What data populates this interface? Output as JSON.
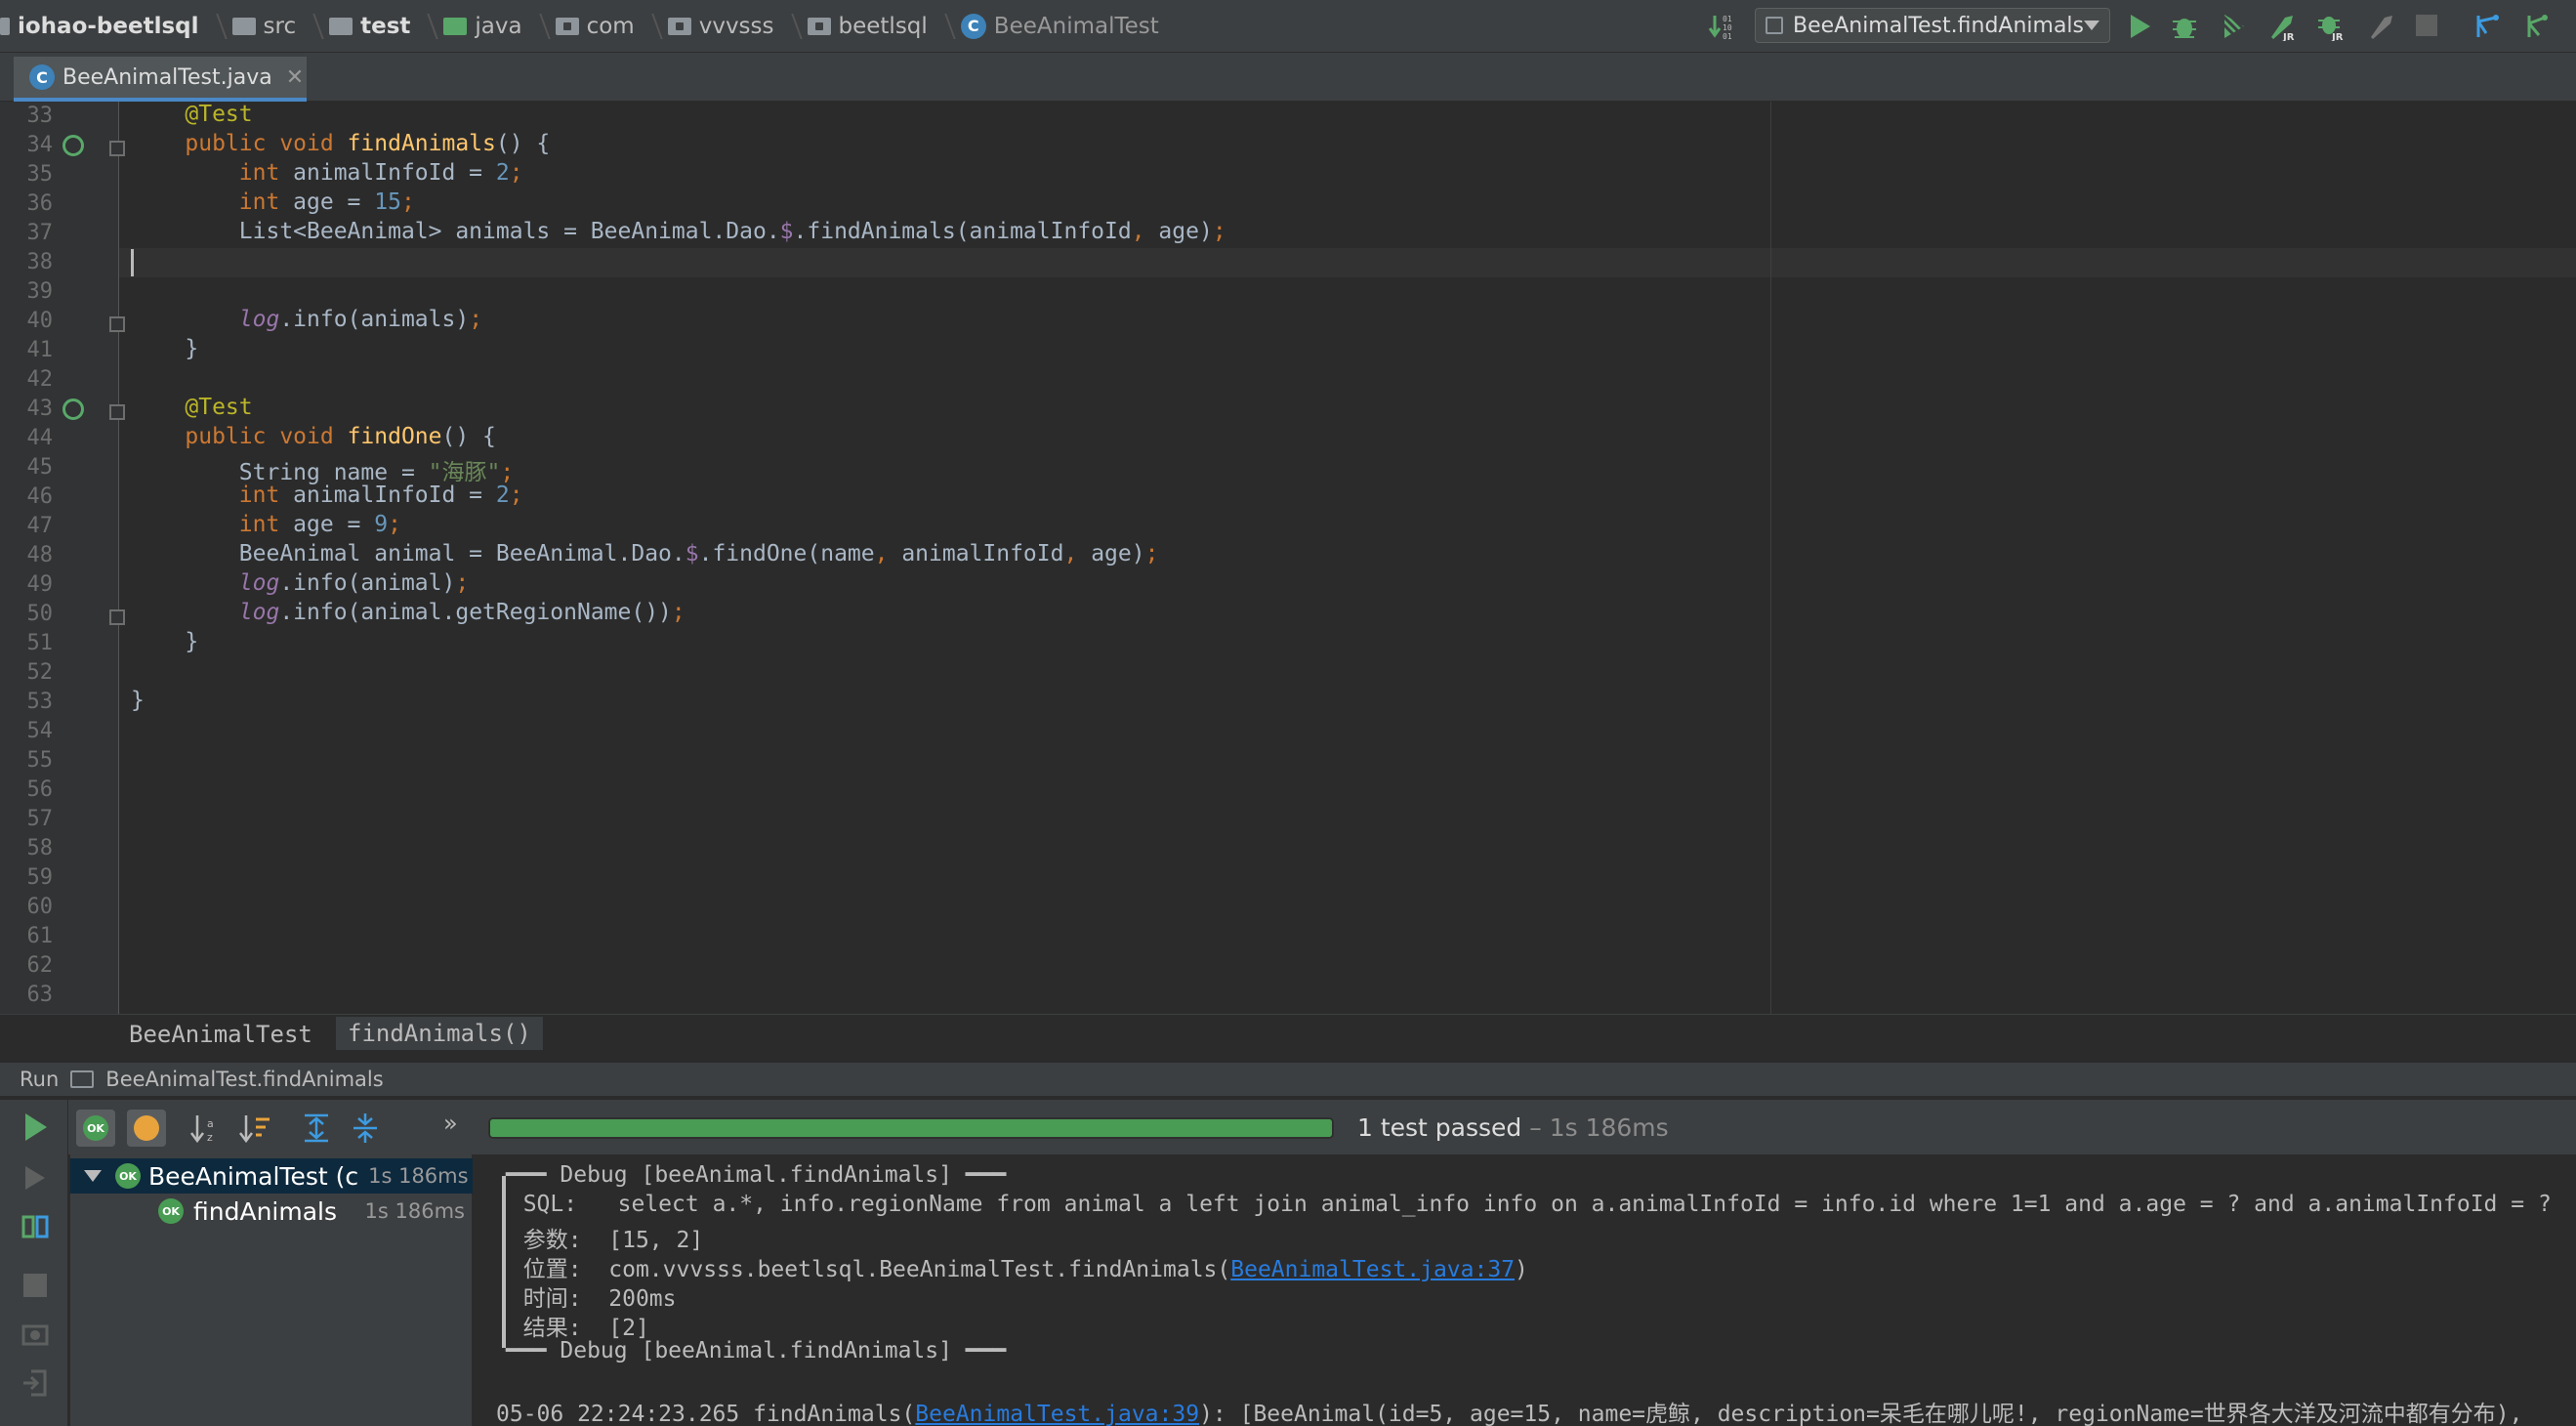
{
  "navbar": {
    "crumbs": [
      {
        "label": "iohao-beetlsql",
        "icon": "module-folder-icon",
        "bold": true
      },
      {
        "label": "src",
        "icon": "folder-icon"
      },
      {
        "label": "test",
        "icon": "folder-icon",
        "bold": true
      },
      {
        "label": "java",
        "icon": "green-folder-icon"
      },
      {
        "label": "com",
        "icon": "package-icon"
      },
      {
        "label": "vvvsss",
        "icon": "package-icon"
      },
      {
        "label": "beetlsql",
        "icon": "package-icon"
      },
      {
        "label": "BeeAnimalTest",
        "icon": "class-icon"
      }
    ],
    "run_config": "BeeAnimalTest.findAnimals"
  },
  "editor_tab": {
    "label": "BeeAnimalTest.java",
    "icon_letter": "C"
  },
  "code": {
    "line_numbers": [
      "33",
      "34",
      "35",
      "36",
      "37",
      "38",
      "39",
      "40",
      "41",
      "42",
      "43",
      "44",
      "45",
      "46",
      "47",
      "48",
      "49",
      "50",
      "51",
      "52",
      "53",
      "54",
      "55",
      "56",
      "57",
      "58",
      "59",
      "60",
      "61",
      "62",
      "63"
    ]
  },
  "editor_breadcrumb": {
    "class_name": "BeeAnimalTest",
    "method_name": "findAnimals()"
  },
  "run_panel": {
    "label": "Run",
    "config": "BeeAnimalTest.findAnimals",
    "status_text": "1 test passed",
    "status_time": " – 1s 186ms",
    "progress": 1.0,
    "tree": [
      {
        "label": "BeeAnimalTest (c",
        "duration": "1s 186ms",
        "badge": "OK"
      },
      {
        "label": "findAnimals",
        "duration": "1s 186ms",
        "badge": "OK"
      }
    ]
  },
  "console": {
    "header_top": "Debug [beeAnimal.findAnimals] ━━━",
    "sql_label": "SQL:",
    "sql_value": "select a.*, info.regionName from animal a left join animal_info info on a.animalInfoId = info.id where 1=1 and a.age = ? and a.animalInfoId = ?",
    "params_label": "参数:",
    "params_value": "[15, 2]",
    "location_label": "位置:",
    "location_value": "com.vvvsss.beetlsql.BeeAnimalTest.findAnimals(",
    "location_link": "BeeAnimalTest.java:37",
    "location_end": ")",
    "time_label": "时间:",
    "time_value": "200ms",
    "result_label": "结果:",
    "result_value": "[2]",
    "header_bottom": "Debug [beeAnimal.findAnimals] ━━━",
    "log_prefix": "05-06 22:24:23.265 findAnimals(",
    "log_link": "BeeAnimalTest.java:39",
    "log_rest": "): [BeeAnimal(id=5, age=15, name=虎鲸, description=呆毛在哪儿呢!, regionName=世界各大洋及河流中都有分布),"
  },
  "colors": {
    "accent_green": "#59a869",
    "link_blue": "#287bde",
    "selection": "#0d293e"
  }
}
